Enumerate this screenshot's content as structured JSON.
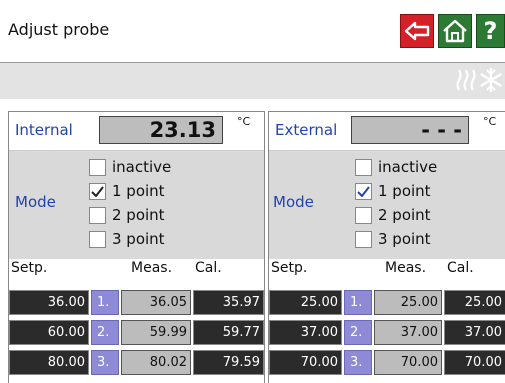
{
  "header": {
    "title": "Adjust probe"
  },
  "buttons": {
    "help_glyph": "?"
  },
  "colors": {
    "back": "#d42028",
    "home": "#2c7a33",
    "label_blue": "#2244aa",
    "index_purple": "#8e8ad6"
  },
  "internal": {
    "label": "Internal",
    "value": "23.13",
    "unit": "°C",
    "mode_label": "Mode",
    "options": [
      {
        "label": "inactive",
        "checked": false
      },
      {
        "label": "1 point",
        "checked": true
      },
      {
        "label": "2 point",
        "checked": false
      },
      {
        "label": "3 point",
        "checked": false
      }
    ],
    "table": {
      "headers": {
        "setp": "Setp.",
        "meas": "Meas.",
        "cal": "Cal."
      },
      "rows": [
        {
          "setp": "36.00",
          "idx": "1.",
          "meas": "36.05",
          "cal": "35.97"
        },
        {
          "setp": "60.00",
          "idx": "2.",
          "meas": "59.99",
          "cal": "59.77"
        },
        {
          "setp": "80.00",
          "idx": "3.",
          "meas": "80.02",
          "cal": "79.59"
        }
      ]
    }
  },
  "external": {
    "label": "External",
    "value": "- - -",
    "unit": "°C",
    "mode_label": "Mode",
    "options": [
      {
        "label": "inactive",
        "checked": false
      },
      {
        "label": "1 point",
        "checked": true
      },
      {
        "label": "2 point",
        "checked": false
      },
      {
        "label": "3 point",
        "checked": false
      }
    ],
    "table": {
      "headers": {
        "setp": "Setp.",
        "meas": "Meas.",
        "cal": "Cal."
      },
      "rows": [
        {
          "setp": "25.00",
          "idx": "1.",
          "meas": "25.00",
          "cal": "25.00"
        },
        {
          "setp": "37.00",
          "idx": "2.",
          "meas": "37.00",
          "cal": "37.00"
        },
        {
          "setp": "70.00",
          "idx": "3.",
          "meas": "70.00",
          "cal": "70.00"
        }
      ]
    }
  },
  "status_icons": [
    "heating-icon",
    "cooling-icon"
  ]
}
